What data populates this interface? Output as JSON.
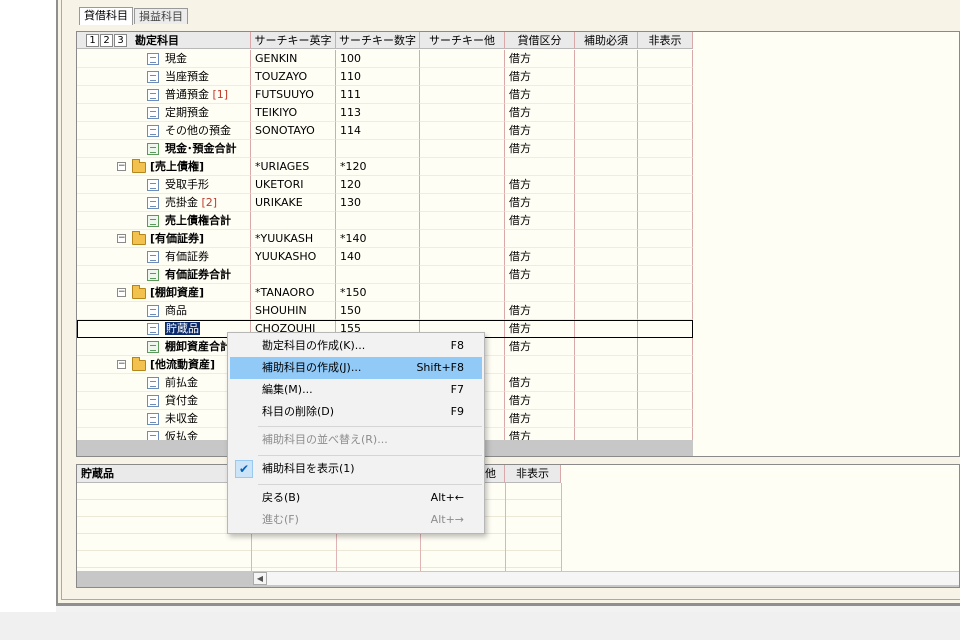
{
  "tabs": [
    {
      "label": "貸借科目",
      "active": true
    },
    {
      "label": "損益科目",
      "active": false
    }
  ],
  "grid": {
    "level_buttons": [
      "1",
      "2",
      "3"
    ],
    "columns": [
      "勘定科目",
      "サーチキー英字",
      "サーチキー数字",
      "サーチキー他",
      "貸借区分",
      "補助必須",
      "非表示"
    ],
    "rows": [
      {
        "name": "現金",
        "suffix": "",
        "icon": "account-doc",
        "bold": false,
        "en": "GENKIN",
        "num": "100",
        "kubun": "借方"
      },
      {
        "name": "当座預金",
        "suffix": "",
        "icon": "account-doc",
        "bold": false,
        "en": "TOUZAYO",
        "num": "110",
        "kubun": "借方"
      },
      {
        "name": "普通預金",
        "suffix": "[1]",
        "icon": "account-doc",
        "bold": false,
        "en": "FUTSUUYO",
        "num": "111",
        "kubun": "借方"
      },
      {
        "name": "定期預金",
        "suffix": "",
        "icon": "account-doc",
        "bold": false,
        "en": "TEIKIYO",
        "num": "113",
        "kubun": "借方"
      },
      {
        "name": "その他の預金",
        "suffix": "",
        "icon": "account-doc",
        "bold": false,
        "en": "SONOTAYO",
        "num": "114",
        "kubun": "借方"
      },
      {
        "name": "現金･預金合計",
        "suffix": "",
        "icon": "sum",
        "bold": true,
        "en": "",
        "num": "",
        "kubun": "借方"
      },
      {
        "name": "[売上債権]",
        "suffix": "",
        "icon": "folder",
        "bold": true,
        "en": "*URIAGES",
        "num": "*120",
        "kubun": ""
      },
      {
        "name": "受取手形",
        "suffix": "",
        "icon": "account-doc",
        "bold": false,
        "en": "UKETORI",
        "num": "120",
        "kubun": "借方"
      },
      {
        "name": "売掛金",
        "suffix": "[2]",
        "icon": "account-doc",
        "bold": false,
        "en": "URIKAKE",
        "num": "130",
        "kubun": "借方"
      },
      {
        "name": "売上債権合計",
        "suffix": "",
        "icon": "sum",
        "bold": true,
        "en": "",
        "num": "",
        "kubun": "借方"
      },
      {
        "name": "[有価証券]",
        "suffix": "",
        "icon": "folder",
        "bold": true,
        "en": "*YUUKASH",
        "num": "*140",
        "kubun": ""
      },
      {
        "name": "有価証券",
        "suffix": "",
        "icon": "account-doc",
        "bold": false,
        "en": "YUUKASHO",
        "num": "140",
        "kubun": "借方"
      },
      {
        "name": "有価証券合計",
        "suffix": "",
        "icon": "sum",
        "bold": true,
        "en": "",
        "num": "",
        "kubun": "借方"
      },
      {
        "name": "[棚卸資産]",
        "suffix": "",
        "icon": "folder",
        "bold": true,
        "en": "*TANAORO",
        "num": "*150",
        "kubun": ""
      },
      {
        "name": "商品",
        "suffix": "",
        "icon": "account-doc",
        "bold": false,
        "en": "SHOUHIN",
        "num": "150",
        "kubun": "借方"
      },
      {
        "name": "貯蔵品",
        "suffix": "",
        "icon": "account-doc",
        "bold": false,
        "en": "CHOZOUHI",
        "num": "155",
        "kubun": "借方",
        "selected": true
      },
      {
        "name": "棚卸資産合計",
        "suffix": "",
        "icon": "sum",
        "bold": true,
        "en": "",
        "num": "",
        "kubun": "借方"
      },
      {
        "name": "[他流動資産]",
        "suffix": "",
        "icon": "folder",
        "bold": true,
        "en": "",
        "num": "",
        "kubun": ""
      },
      {
        "name": "前払金",
        "suffix": "",
        "icon": "account-doc",
        "bold": false,
        "en": "",
        "num": "",
        "kubun": "借方"
      },
      {
        "name": "貸付金",
        "suffix": "",
        "icon": "account-doc",
        "bold": false,
        "en": "",
        "num": "",
        "kubun": "借方"
      },
      {
        "name": "未収金",
        "suffix": "",
        "icon": "account-doc",
        "bold": false,
        "en": "",
        "num": "",
        "kubun": "借方"
      },
      {
        "name": "仮払金",
        "suffix": "",
        "icon": "account-doc",
        "bold": false,
        "en": "",
        "num": "",
        "kubun": "借方"
      }
    ]
  },
  "sub_grid": {
    "title": "貯蔵品",
    "columns": [
      "他",
      "非表示"
    ]
  },
  "context_menu": {
    "items": [
      {
        "label": "勘定科目の作成(K)...",
        "shortcut": "F8",
        "highlighted": false,
        "disabled": false,
        "checked": false
      },
      {
        "label": "補助科目の作成(J)...",
        "shortcut": "Shift+F8",
        "highlighted": true,
        "disabled": false,
        "checked": false
      },
      {
        "label": "編集(M)...",
        "shortcut": "F7",
        "highlighted": false,
        "disabled": false,
        "checked": false
      },
      {
        "label": "科目の削除(D)",
        "shortcut": "F9",
        "highlighted": false,
        "disabled": false,
        "checked": false
      },
      {
        "label": "補助科目の並べ替え(R)...",
        "shortcut": "",
        "highlighted": false,
        "disabled": true,
        "checked": false
      },
      {
        "label": "補助科目を表示(1)",
        "shortcut": "",
        "highlighted": false,
        "disabled": false,
        "checked": true
      },
      {
        "label": "戻る(B)",
        "shortcut": "Alt+←",
        "highlighted": false,
        "disabled": false,
        "checked": false
      },
      {
        "label": "進む(F)",
        "shortcut": "Alt+→",
        "highlighted": false,
        "disabled": true,
        "checked": false
      }
    ]
  },
  "colors": {
    "grid_background": "#fffef5",
    "column_divider": "#d9a8a8",
    "menu_highlight": "#91c9f7",
    "selection_text_bg": "#0a2a6b"
  }
}
